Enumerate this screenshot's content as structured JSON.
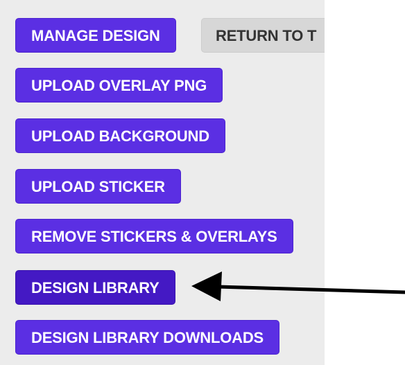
{
  "buttons": {
    "manage_design": "MANAGE DESIGN",
    "return_to": "RETURN TO T",
    "upload_overlay": "UPLOAD OVERLAY PNG",
    "upload_background": "UPLOAD BACKGROUND",
    "upload_sticker": "UPLOAD STICKER",
    "remove_stickers": "REMOVE STICKERS & OVERLAYS",
    "design_library": "DESIGN LIBRARY",
    "design_library_downloads": "DESIGN LIBRARY DOWNLOADS"
  },
  "colors": {
    "primary": "#5b2fe3",
    "active": "#4419c4",
    "secondary": "#d7d7d7",
    "panel": "#ececec",
    "arrow": "#000000"
  },
  "annotation": {
    "icon": "arrow-left-icon",
    "points_to": "design_library"
  }
}
